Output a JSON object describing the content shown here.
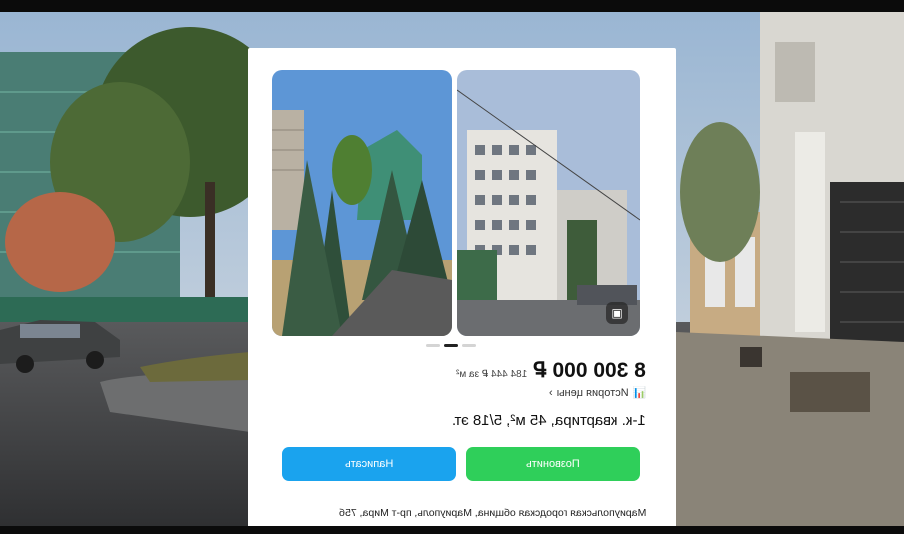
{
  "listing": {
    "price": "8 300 000 ₽",
    "price_per_m2": "184 444 ₽ за м²",
    "price_history_link": "История цены",
    "title": "1-к. квартира, 45 м², 5/18 эт.",
    "call_button": "Позвонить",
    "write_button": "Написать",
    "address": "Мариупольская городская община, Мариуполь, пр-т Мира, 75б"
  },
  "icons": {
    "history": "chart-icon",
    "chevron": "chevron-right-icon",
    "gallery": "gallery-icon"
  },
  "colors": {
    "call": "#2fcf5a",
    "write": "#1aa3ee"
  }
}
